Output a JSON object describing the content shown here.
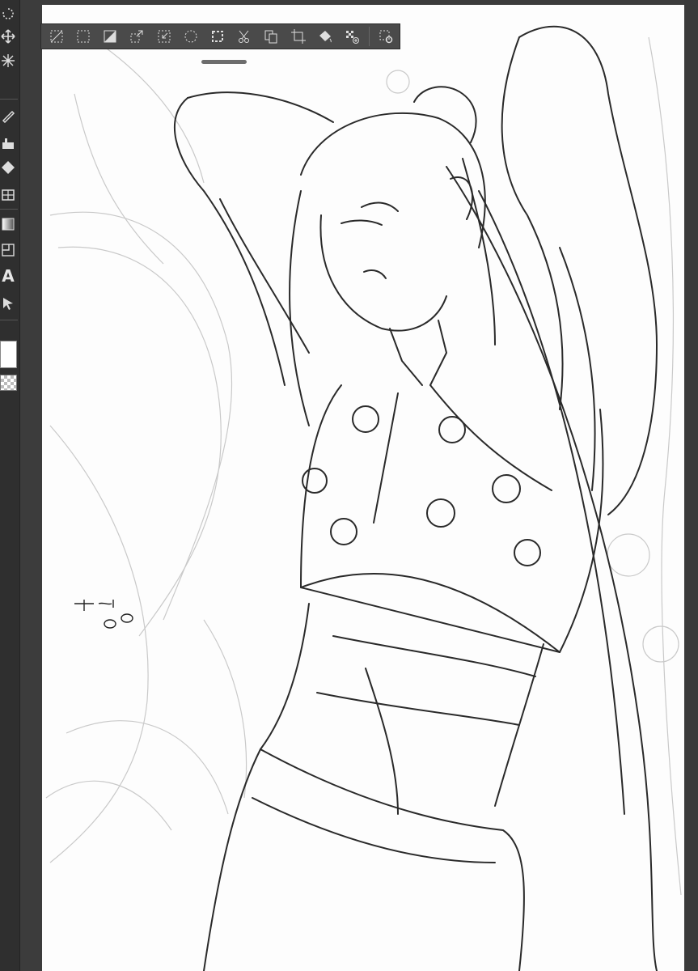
{
  "app": {
    "accent": "#4a4a4a",
    "canvas_bg": "#fdfdfd",
    "ui_bg": "#3a3a3a"
  },
  "tools": [
    {
      "name": "rotate-tool",
      "icon": "rotate-icon"
    },
    {
      "name": "move-tool",
      "icon": "move-icon"
    },
    {
      "name": "magic-wand-tool",
      "icon": "sparkle-icon"
    },
    {
      "name": "pen-tool",
      "icon": "pen-icon"
    },
    {
      "name": "brush-tool",
      "icon": "brush-icon"
    },
    {
      "name": "eraser-tool",
      "icon": "eraser-icon"
    },
    {
      "name": "fill-tool",
      "icon": "fill-icon"
    },
    {
      "name": "gradient-tool",
      "icon": "gradient-icon"
    },
    {
      "name": "frame-tool",
      "icon": "frame-icon"
    },
    {
      "name": "text-tool",
      "icon": "text-icon",
      "glyph": "A"
    },
    {
      "name": "select-object-tool",
      "icon": "cursor-icon"
    }
  ],
  "selection_toolbar": {
    "buttons": [
      "deselect-icon",
      "select-all-icon",
      "invert-selection-icon",
      "expand-selection-icon",
      "shrink-selection-icon",
      "feather-icon",
      "selection-border-icon",
      "cut-icon",
      "copy-paste-icon",
      "crop-icon",
      "fill-selection-icon",
      "pattern-icon",
      "settings-icon"
    ]
  },
  "signature": {
    "text": "ネコ"
  }
}
